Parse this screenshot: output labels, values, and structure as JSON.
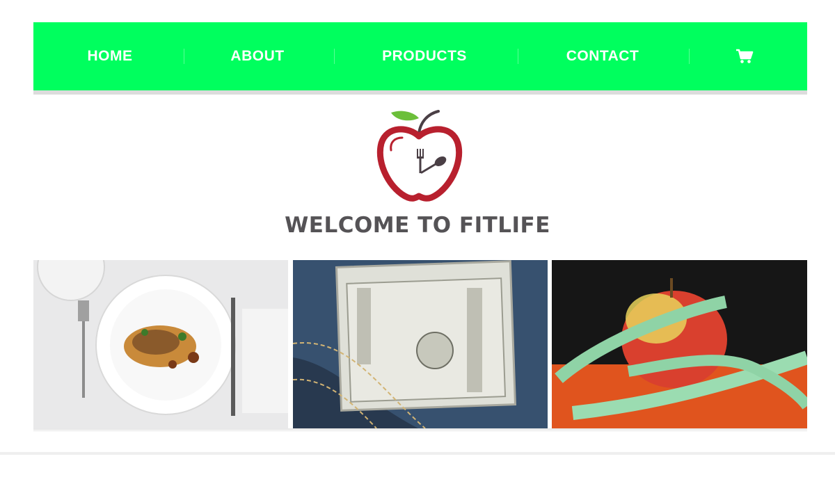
{
  "nav": {
    "items": [
      {
        "label": "HOME"
      },
      {
        "label": "ABOUT"
      },
      {
        "label": "PRODUCTS"
      },
      {
        "label": "CONTACT"
      }
    ],
    "cart_icon": "shopping-cart-icon",
    "background_color": "#00ff5e",
    "text_color": "#ffffff"
  },
  "logo": {
    "icon": "apple-clock-fork-spoon-logo",
    "colors": {
      "apple": "#b8202e",
      "leaf": "#6cbf3a",
      "utensils": "#4a3f45"
    }
  },
  "hero": {
    "title": "WELCOME TO FITLIFE",
    "title_color": "#555356"
  },
  "gallery": {
    "tiles": [
      {
        "subject": "plated-meal-photo"
      },
      {
        "subject": "money-in-jeans-pocket-photo"
      },
      {
        "subject": "apple-with-measuring-tape-photo"
      }
    ]
  }
}
